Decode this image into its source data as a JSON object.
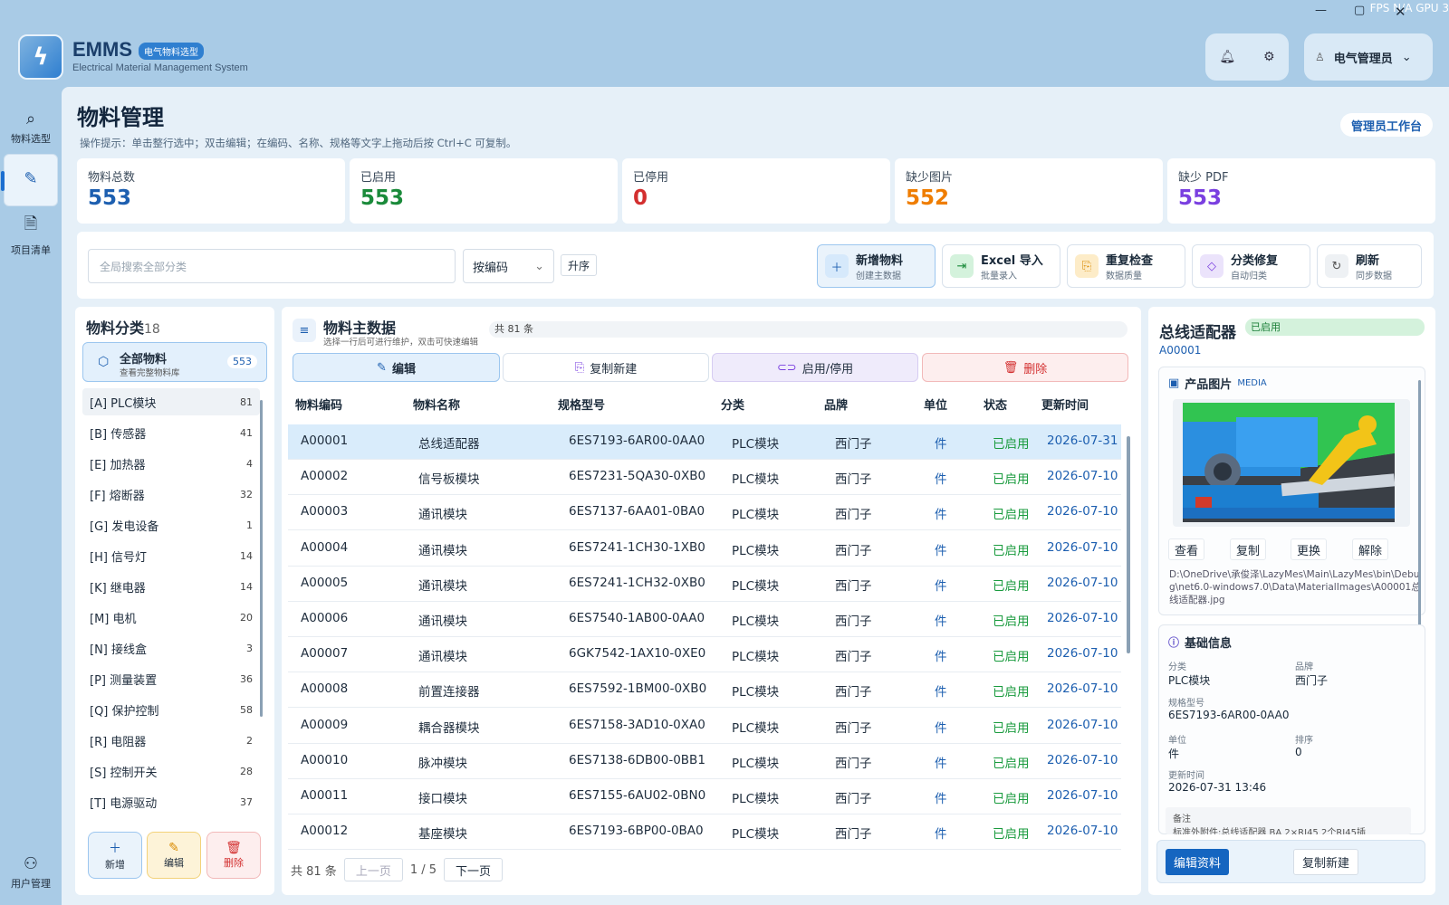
{
  "window": {
    "fps_text": "FPS  N/A    GPU  3",
    "minimize": "—",
    "maximize": "▢",
    "close": "✕"
  },
  "app": {
    "title": "EMMS",
    "badge": "电气物料选型",
    "subtitle": "Electrical Material Management System",
    "logo_icon": "lightning-icon"
  },
  "header": {
    "user": "电气管理员"
  },
  "sidebar": {
    "items": [
      {
        "label": "物料选型",
        "icon": "search-icon"
      },
      {
        "label": "物料管理",
        "icon": "pencil-icon"
      },
      {
        "label": "项目清单",
        "icon": "document-icon"
      },
      {
        "label": "用户管理",
        "icon": "users-icon"
      }
    ]
  },
  "page": {
    "title": "物料管理",
    "hint": "操作提示：单击整行选中；双击编辑；在编码、名称、规格等文字上拖动后按 Ctrl+C 可复制。",
    "admin_button": "管理员工作台"
  },
  "stats": [
    {
      "label": "物料总数",
      "value": "553",
      "color": "#1d5fb0"
    },
    {
      "label": "已启用",
      "value": "553",
      "color": "#1a8a3a"
    },
    {
      "label": "已停用",
      "value": "0",
      "color": "#d32f2f"
    },
    {
      "label": "缺少图片",
      "value": "552",
      "color": "#ef7d00"
    },
    {
      "label": "缺少 PDF",
      "value": "553",
      "color": "#7a3fe0"
    }
  ],
  "toolbar": {
    "search_placeholder": "全局搜索全部分类",
    "sort_select": "按编码",
    "order_button": "升序",
    "buttons": [
      {
        "title": "新增物料",
        "sub": "创建主数据",
        "icon": "＋",
        "icon_bg": "#d6e9fb",
        "icon_color": "#1d5fb0"
      },
      {
        "title": "Excel 导入",
        "sub": "批量录入",
        "icon": "⇥",
        "icon_bg": "#d4f2dc",
        "icon_color": "#1a8a3a"
      },
      {
        "title": "重复检查",
        "sub": "数据质量",
        "icon": "⎘",
        "icon_bg": "#fdecc8",
        "icon_color": "#d98a00"
      },
      {
        "title": "分类修复",
        "sub": "自动归类",
        "icon": "◇",
        "icon_bg": "#ebe3fb",
        "icon_color": "#7a3fe0"
      },
      {
        "title": "刷新",
        "sub": "同步数据",
        "icon": "↻",
        "icon_bg": "#eef1f4",
        "icon_color": "#555"
      }
    ]
  },
  "categories": {
    "title": "物料分类",
    "count": "18",
    "all": {
      "name": "全部物料",
      "sub": "查看完整物料库",
      "count": "553"
    },
    "items": [
      {
        "name": "[A] PLC模块",
        "count": "81"
      },
      {
        "name": "[B] 传感器",
        "count": "41"
      },
      {
        "name": "[E] 加热器",
        "count": "4"
      },
      {
        "name": "[F] 熔断器",
        "count": "32"
      },
      {
        "name": "[G] 发电设备",
        "count": "1"
      },
      {
        "name": "[H] 信号灯",
        "count": "14"
      },
      {
        "name": "[K] 继电器",
        "count": "14"
      },
      {
        "name": "[M] 电机",
        "count": "20"
      },
      {
        "name": "[N] 接线盒",
        "count": "3"
      },
      {
        "name": "[P] 测量装置",
        "count": "36"
      },
      {
        "name": "[Q] 保护控制",
        "count": "58"
      },
      {
        "name": "[R] 电阻器",
        "count": "2"
      },
      {
        "name": "[S] 控制开关",
        "count": "28"
      },
      {
        "name": "[T] 电源驱动",
        "count": "37"
      }
    ],
    "actions": {
      "add": "新增",
      "edit": "编辑",
      "delete": "删除"
    }
  },
  "table": {
    "title": "物料主数据",
    "subtitle": "选择一行后可进行维护，双击可快速编辑",
    "count_text": "共 81 条",
    "actions": {
      "edit": "编辑",
      "copy_new": "复制新建",
      "toggle": "启用/停用",
      "delete": "删除"
    },
    "columns": [
      "物料编码",
      "物料名称",
      "规格型号",
      "分类",
      "品牌",
      "单位",
      "状态",
      "更新时间"
    ],
    "rows": [
      [
        "A00001",
        "总线适配器",
        "6ES7193-6AR00-0AA0",
        "PLC模块",
        "西门子",
        "件",
        "已启用",
        "2026-07-31"
      ],
      [
        "A00002",
        "信号板模块",
        "6ES7231-5QA30-0XB0",
        "PLC模块",
        "西门子",
        "件",
        "已启用",
        "2026-07-10"
      ],
      [
        "A00003",
        "通讯模块",
        "6ES7137-6AA01-0BA0",
        "PLC模块",
        "西门子",
        "件",
        "已启用",
        "2026-07-10"
      ],
      [
        "A00004",
        "通讯模块",
        "6ES7241-1CH30-1XB0",
        "PLC模块",
        "西门子",
        "件",
        "已启用",
        "2026-07-10"
      ],
      [
        "A00005",
        "通讯模块",
        "6ES7241-1CH32-0XB0",
        "PLC模块",
        "西门子",
        "件",
        "已启用",
        "2026-07-10"
      ],
      [
        "A00006",
        "通讯模块",
        "6ES7540-1AB00-0AA0",
        "PLC模块",
        "西门子",
        "件",
        "已启用",
        "2026-07-10"
      ],
      [
        "A00007",
        "通讯模块",
        "6GK7542-1AX10-0XE0",
        "PLC模块",
        "西门子",
        "件",
        "已启用",
        "2026-07-10"
      ],
      [
        "A00008",
        "前置连接器",
        "6ES7592-1BM00-0XB0",
        "PLC模块",
        "西门子",
        "件",
        "已启用",
        "2026-07-10"
      ],
      [
        "A00009",
        "耦合器模块",
        "6ES7158-3AD10-0XA0",
        "PLC模块",
        "西门子",
        "件",
        "已启用",
        "2026-07-10"
      ],
      [
        "A00010",
        "脉冲模块",
        "6ES7138-6DB00-0BB1",
        "PLC模块",
        "西门子",
        "件",
        "已启用",
        "2026-07-10"
      ],
      [
        "A00011",
        "接口模块",
        "6ES7155-6AU02-0BN0",
        "PLC模块",
        "西门子",
        "件",
        "已启用",
        "2026-07-10"
      ],
      [
        "A00012",
        "基座模块",
        "6ES7193-6BP00-0BA0",
        "PLC模块",
        "西门子",
        "件",
        "已启用",
        "2026-07-10"
      ]
    ],
    "pager": {
      "total": "共 81 条",
      "prev": "上一页",
      "page": "1 / 5",
      "next": "下一页"
    }
  },
  "detail": {
    "name": "总线适配器",
    "status": "已启用",
    "code": "A00001",
    "image_section": {
      "title": "产品图片",
      "tag": "MEDIA"
    },
    "image_actions": [
      "查看",
      "复制",
      "更换",
      "解除"
    ],
    "image_path": "D:\\OneDrive\\承俊泽\\LazyMes\\Main\\LazyMes\\bin\\Debug\\net6.0-windows7.0\\Data\\MaterialImages\\A00001总线适配器.jpg",
    "info_section": {
      "title": "基础信息"
    },
    "fields": {
      "category_label": "分类",
      "category": "PLC模块",
      "brand_label": "品牌",
      "brand": "西门子",
      "spec_label": "规格型号",
      "spec": "6ES7193-6AR00-0AA0",
      "unit_label": "单位",
      "unit": "件",
      "sort_label": "排序",
      "sort": "0",
      "updated_label": "更新时间",
      "updated": "2026-07-31 13:46",
      "remark_label": "备注",
      "remark": "标准外附件:总线适配器 BA 2×RJ45 2个RJ45插"
    },
    "buttons": {
      "edit": "编辑资料",
      "copy": "复制新建"
    }
  }
}
